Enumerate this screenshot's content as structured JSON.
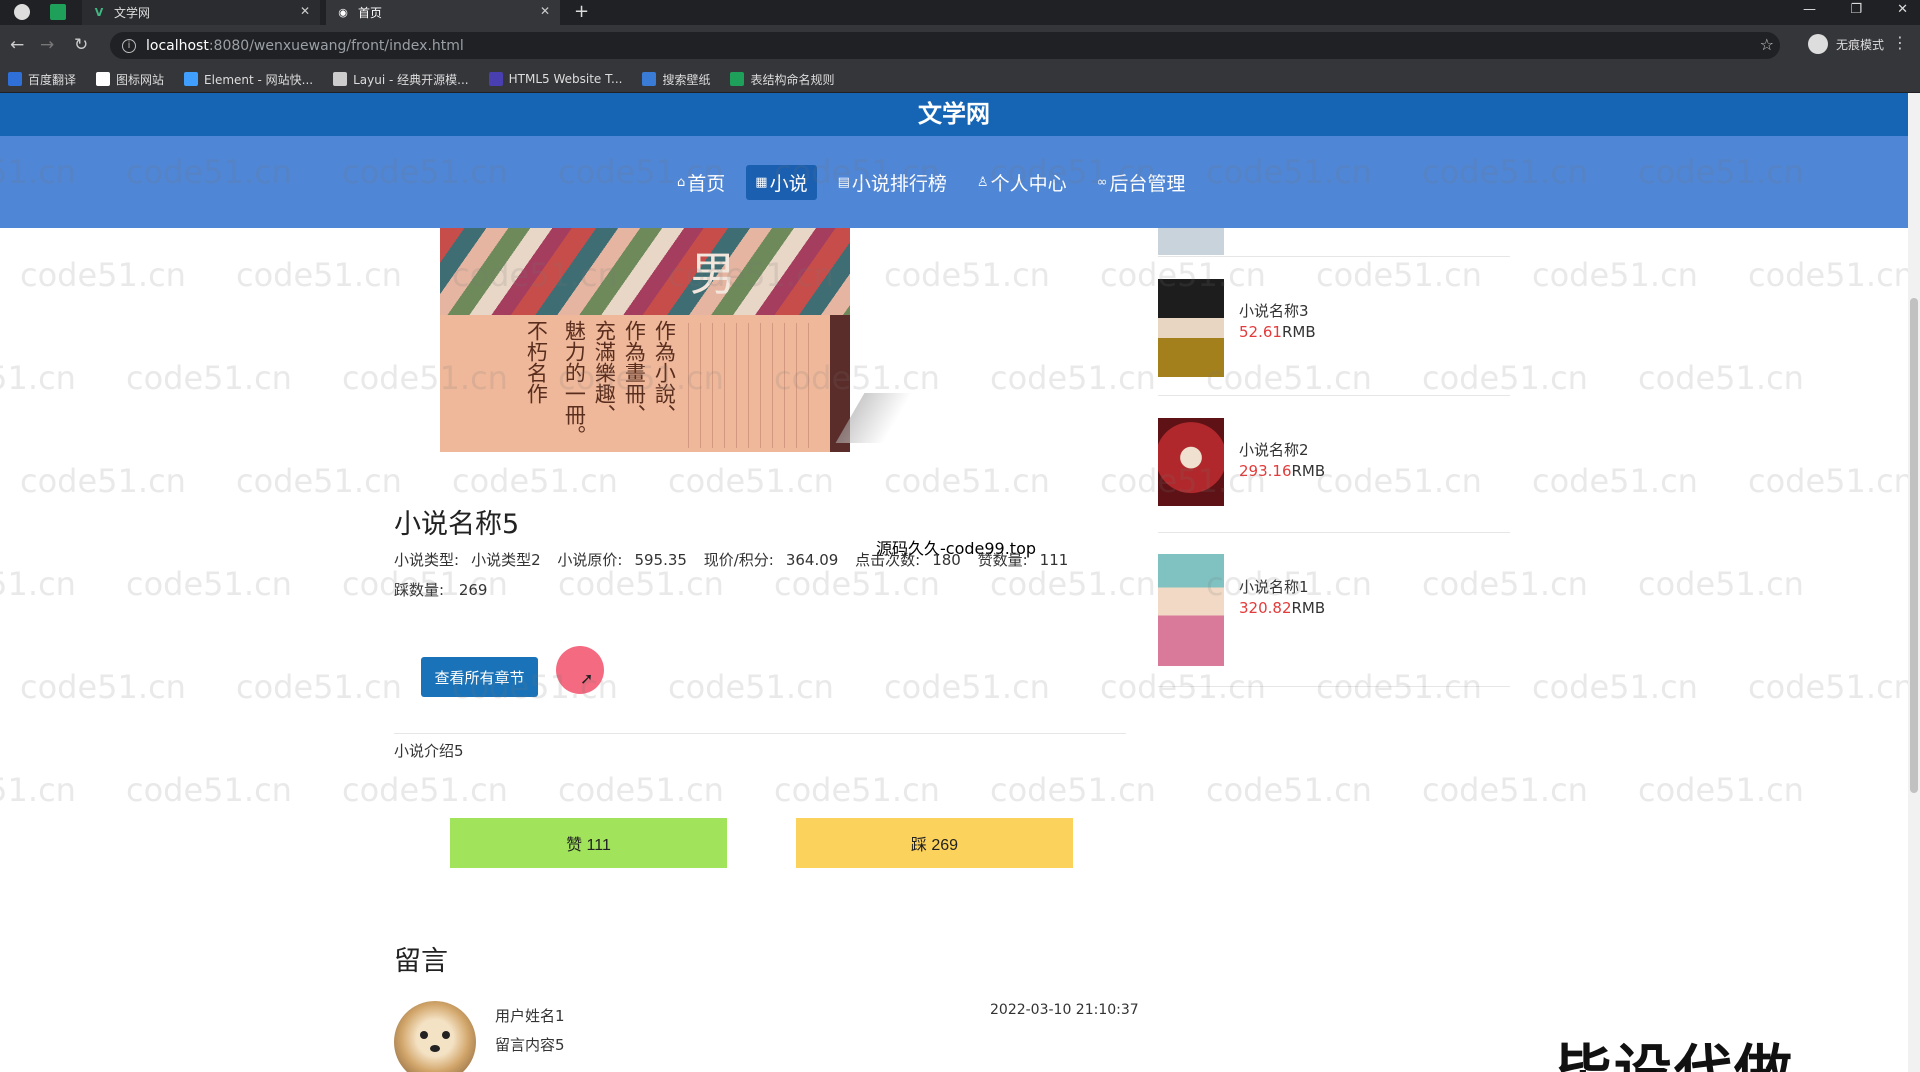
{
  "browser": {
    "tabs": [
      {
        "title": "文学网",
        "active": false
      },
      {
        "title": "首页",
        "active": true
      }
    ],
    "new_tab_label": "+",
    "url_host": "localhost",
    "url_path": ":8080/wenxuewang/front/index.html",
    "incognito_label": "无痕模式",
    "bookmarks": [
      {
        "label": "百度翻译",
        "color": "#2f6fd8"
      },
      {
        "label": "图标网站",
        "color": "#ffffff"
      },
      {
        "label": "Element - 网站快...",
        "color": "#409eff"
      },
      {
        "label": "Layui - 经典开源模...",
        "color": "#cccccc"
      },
      {
        "label": "HTML5 Website T...",
        "color": "#4a3fb0"
      },
      {
        "label": "搜索壁纸",
        "color": "#3a7bd5"
      },
      {
        "label": "表结构命名规则",
        "color": "#1ea05a"
      }
    ]
  },
  "site": {
    "title": "文学网",
    "nav": [
      {
        "label": "首页",
        "icon": "home-icon",
        "glyph": "⌂",
        "active": false
      },
      {
        "label": "小说",
        "icon": "grid-icon",
        "glyph": "▦",
        "active": true
      },
      {
        "label": "小说排行榜",
        "icon": "ranking-icon",
        "glyph": "▤",
        "active": false
      },
      {
        "label": "个人中心",
        "icon": "user-icon",
        "glyph": "♙",
        "active": false
      },
      {
        "label": "后台管理",
        "icon": "link-icon",
        "glyph": "∞",
        "active": false
      }
    ]
  },
  "book": {
    "cover_big_text": "男",
    "cover_columns": [
      "作為小說、",
      "作為畫冊、",
      "充滿樂趣、",
      "魅力的一冊。"
    ],
    "cover_side": "不朽名作",
    "title": "小说名称5",
    "type_label": "小说类型:",
    "type_value": "小说类型2",
    "orig_price_label": "小说原价:",
    "orig_price_value": "595.35",
    "price_label": "现价/积分:",
    "price_value": "364.09",
    "clicks_label": "点击次数:",
    "clicks_value": "180",
    "likes_label": "赞数量:",
    "likes_value": "111",
    "dislikes_label": "踩数量:",
    "dislikes_value": "269",
    "source_note": "源码久久-code99.top",
    "chapters_button": "查看所有章节",
    "intro": "小说介绍5",
    "like_button": "赞  111",
    "dislike_button": "踩  269"
  },
  "comments": {
    "title": "留言",
    "items": [
      {
        "user": "用户姓名1",
        "content": "留言内容5",
        "time": "2022-03-10 21:10:37"
      }
    ]
  },
  "sidebar": {
    "items": [
      {
        "name": "小说名称3",
        "price": "52.61",
        "unit": "RMB"
      },
      {
        "name": "小说名称2",
        "price": "293.16",
        "unit": "RMB"
      },
      {
        "name": "小说名称1",
        "price": "320.82",
        "unit": "RMB"
      }
    ]
  },
  "overlay": {
    "brand": "毕设代做",
    "watermark": "code51.cn"
  }
}
